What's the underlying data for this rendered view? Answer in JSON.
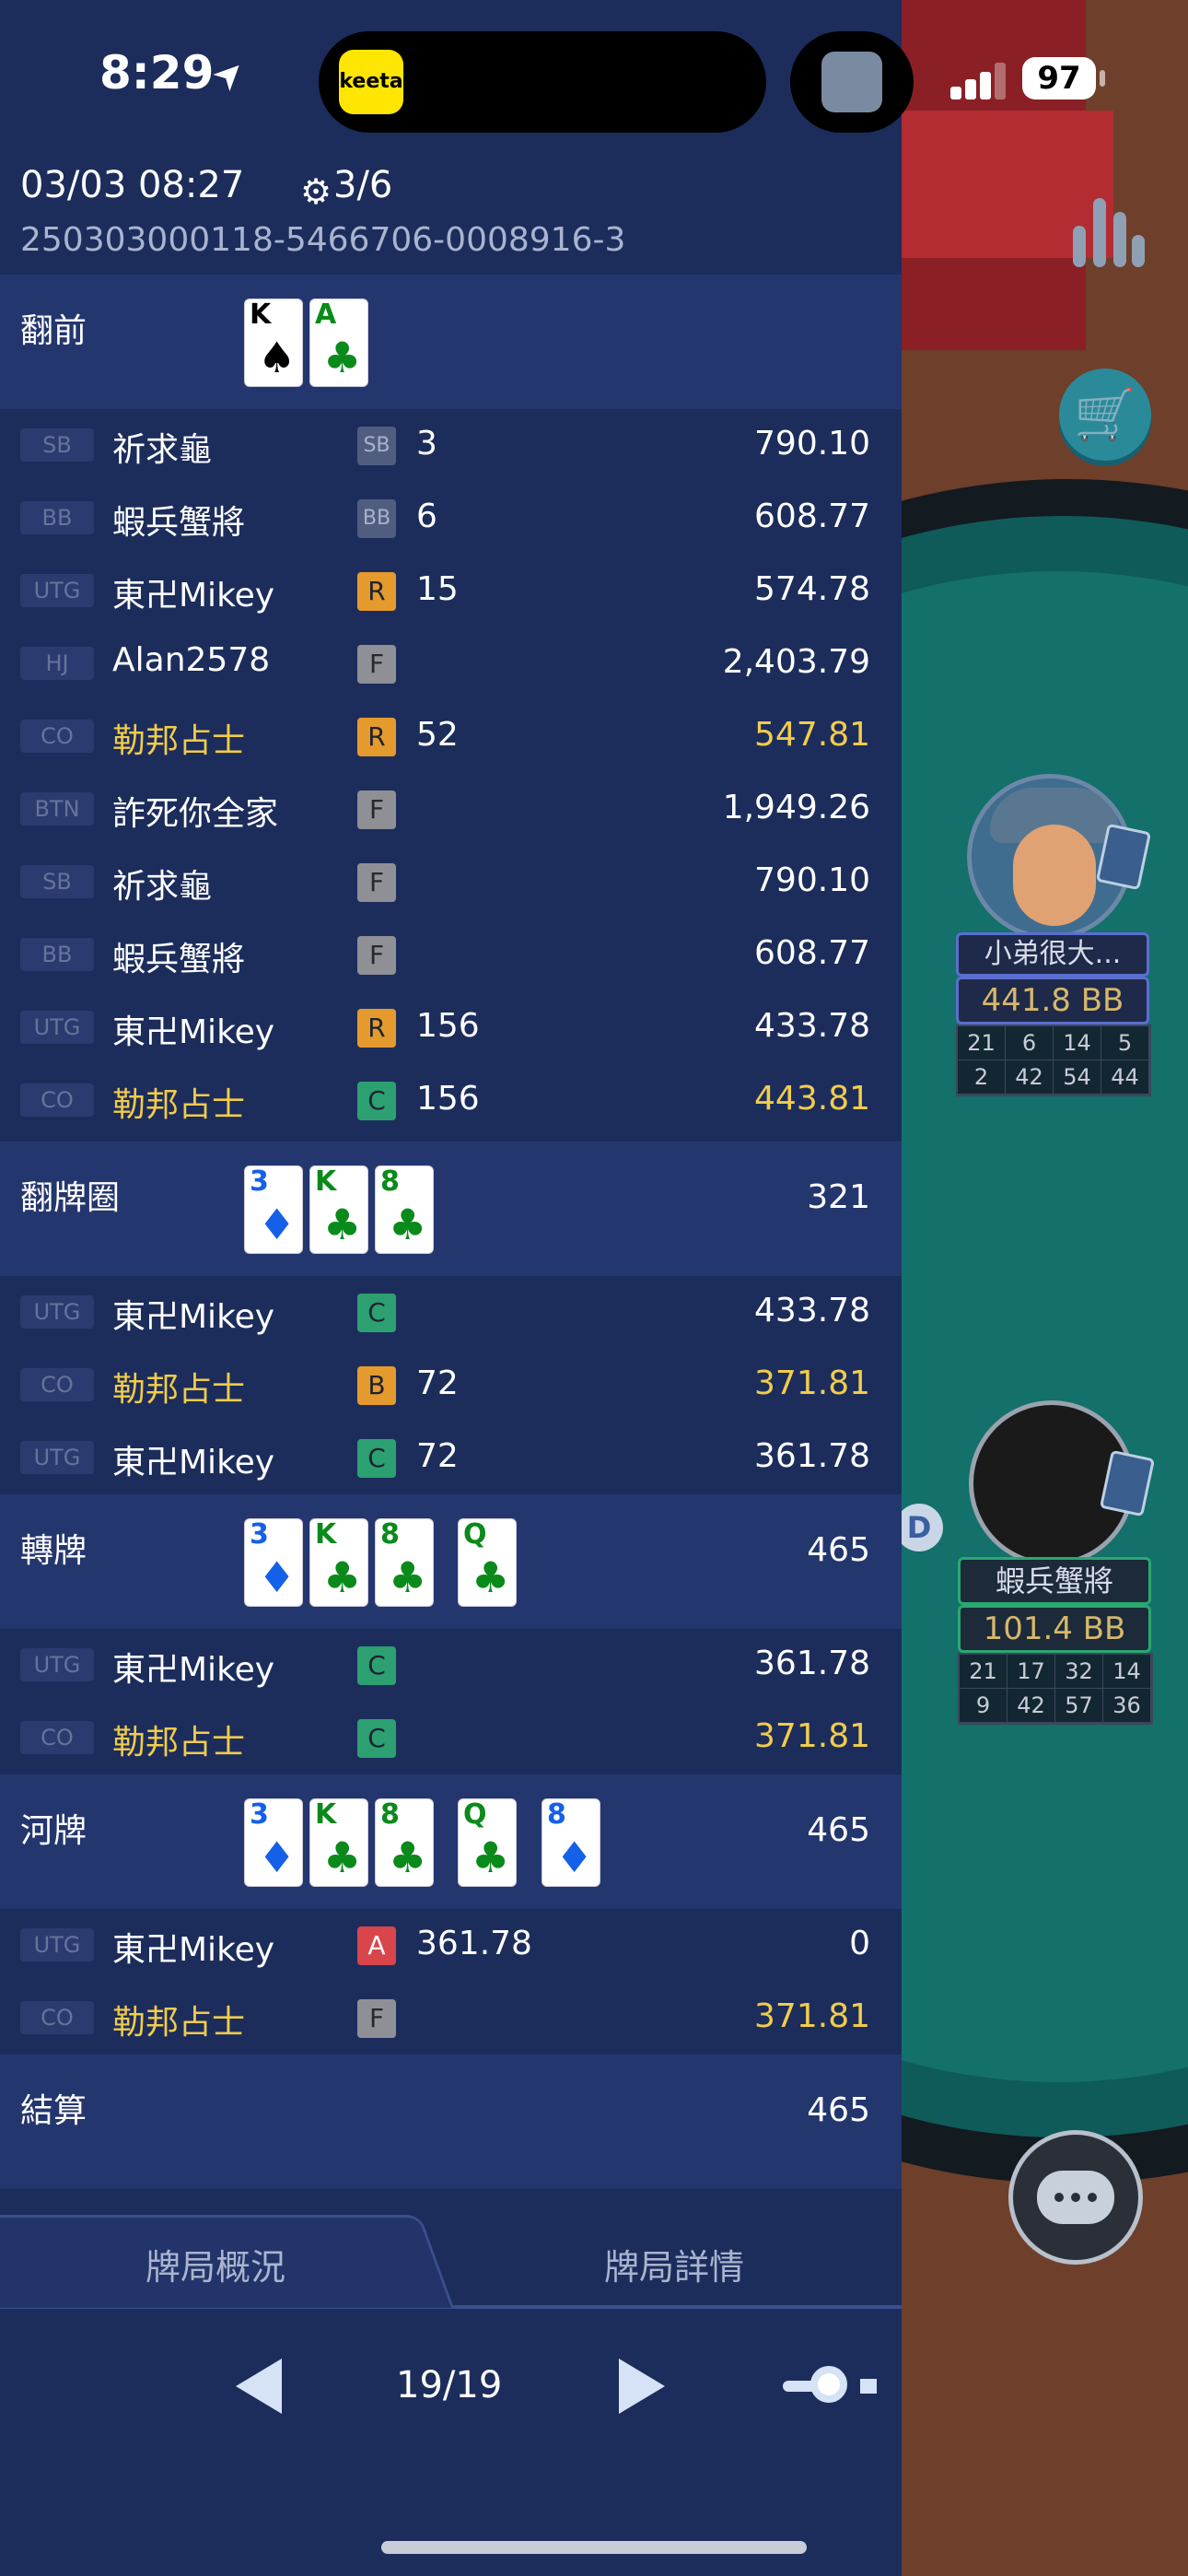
{
  "status_bar": {
    "time": "8:29",
    "battery": "97",
    "app_badge": "keeta"
  },
  "hand": {
    "datetime": "03/03 08:27",
    "count": "3/6",
    "id": "250303000118-5466706-0008916-3"
  },
  "streets": {
    "preflop": {
      "title": "翻前",
      "cards": [
        {
          "rank": "K",
          "suit": "♠",
          "color": "spade"
        },
        {
          "rank": "A",
          "suit": "♣",
          "color": "club"
        }
      ],
      "actions": [
        {
          "pos": "SB",
          "player": "祈求龜",
          "act": "SB",
          "amount": "3",
          "stack": "790.10",
          "hero": false
        },
        {
          "pos": "BB",
          "player": "蝦兵蟹將",
          "act": "BB",
          "amount": "6",
          "stack": "608.77",
          "hero": false
        },
        {
          "pos": "UTG",
          "player": "東卍Mikey",
          "act": "R",
          "amount": "15",
          "stack": "574.78",
          "hero": false
        },
        {
          "pos": "HJ",
          "player": "Alan2578",
          "act": "F",
          "amount": "",
          "stack": "2,403.79",
          "hero": false
        },
        {
          "pos": "CO",
          "player": "勒邦占士",
          "act": "R",
          "amount": "52",
          "stack": "547.81",
          "hero": true
        },
        {
          "pos": "BTN",
          "player": "詐死你全家",
          "act": "F",
          "amount": "",
          "stack": "1,949.26",
          "hero": false
        },
        {
          "pos": "SB",
          "player": "祈求龜",
          "act": "F",
          "amount": "",
          "stack": "790.10",
          "hero": false
        },
        {
          "pos": "BB",
          "player": "蝦兵蟹將",
          "act": "F",
          "amount": "",
          "stack": "608.77",
          "hero": false
        },
        {
          "pos": "UTG",
          "player": "東卍Mikey",
          "act": "R",
          "amount": "156",
          "stack": "433.78",
          "hero": false
        },
        {
          "pos": "CO",
          "player": "勒邦占士",
          "act": "C",
          "amount": "156",
          "stack": "443.81",
          "hero": true
        }
      ]
    },
    "flop": {
      "title": "翻牌圈",
      "pot": "321",
      "cards": [
        {
          "rank": "3",
          "suit": "♦",
          "color": "diamond"
        },
        {
          "rank": "K",
          "suit": "♣",
          "color": "club"
        },
        {
          "rank": "8",
          "suit": "♣",
          "color": "club"
        }
      ],
      "actions": [
        {
          "pos": "UTG",
          "player": "東卍Mikey",
          "act": "C",
          "amount": "",
          "stack": "433.78",
          "hero": false
        },
        {
          "pos": "CO",
          "player": "勒邦占士",
          "act": "B",
          "amount": "72",
          "stack": "371.81",
          "hero": true
        },
        {
          "pos": "UTG",
          "player": "東卍Mikey",
          "act": "C",
          "amount": "72",
          "stack": "361.78",
          "hero": false
        }
      ]
    },
    "turn": {
      "title": "轉牌",
      "pot": "465",
      "cards": [
        {
          "rank": "3",
          "suit": "♦",
          "color": "diamond"
        },
        {
          "rank": "K",
          "suit": "♣",
          "color": "club"
        },
        {
          "rank": "8",
          "suit": "♣",
          "color": "club"
        },
        {
          "rank": "Q",
          "suit": "♣",
          "color": "club"
        }
      ],
      "actions": [
        {
          "pos": "UTG",
          "player": "東卍Mikey",
          "act": "C",
          "amount": "",
          "stack": "361.78",
          "hero": false
        },
        {
          "pos": "CO",
          "player": "勒邦占士",
          "act": "C",
          "amount": "",
          "stack": "371.81",
          "hero": true
        }
      ]
    },
    "river": {
      "title": "河牌",
      "pot": "465",
      "cards": [
        {
          "rank": "3",
          "suit": "♦",
          "color": "diamond"
        },
        {
          "rank": "K",
          "suit": "♣",
          "color": "club"
        },
        {
          "rank": "8",
          "suit": "♣",
          "color": "club"
        },
        {
          "rank": "Q",
          "suit": "♣",
          "color": "club"
        },
        {
          "rank": "8",
          "suit": "♦",
          "color": "diamond"
        }
      ],
      "actions": [
        {
          "pos": "UTG",
          "player": "東卍Mikey",
          "act": "A",
          "amount": "361.78",
          "stack": "0",
          "hero": false
        },
        {
          "pos": "CO",
          "player": "勒邦占士",
          "act": "F",
          "amount": "",
          "stack": "371.81",
          "hero": true
        }
      ]
    },
    "settle": {
      "title": "結算",
      "pot": "465"
    }
  },
  "tabs": {
    "overview": "牌局概況",
    "detail": "牌局詳情",
    "active": "overview"
  },
  "pager": {
    "text": "19/19"
  },
  "seats": [
    {
      "name": "小弟很大...",
      "stack": "441.8 BB",
      "stats": [
        "21",
        "6",
        "14",
        "5",
        "2",
        "42",
        "54",
        "44"
      ]
    },
    {
      "name": "蝦兵蟹將",
      "stack": "101.4 BB",
      "stats": [
        "21",
        "17",
        "32",
        "14",
        "9",
        "42",
        "57",
        "36"
      ]
    }
  ],
  "dealer_button": "D",
  "colors": {
    "panel_bg": "#1c2d5c",
    "street_bg": "#24366e",
    "hero_text": "#f2cc4b",
    "raise": "#e59a2e",
    "call": "#2ca071",
    "fold": "#8e9096",
    "allin": "#d8454a",
    "felt": "#13706b"
  }
}
